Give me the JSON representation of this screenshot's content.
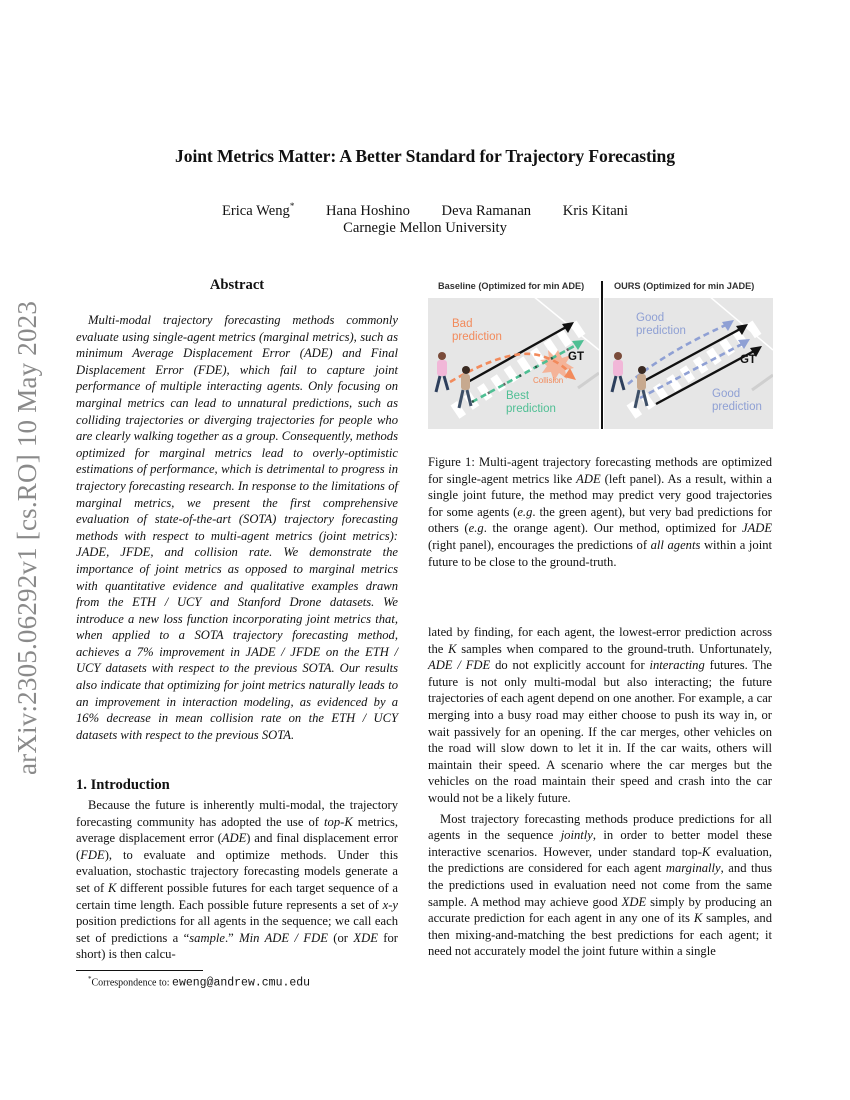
{
  "arxiv_stamp": "arXiv:2305.06292v1  [cs.RO]  10 May 2023",
  "title": "Joint Metrics Matter: A Better Standard for Trajectory Forecasting",
  "authors": [
    {
      "name": "Erica Weng",
      "mark": "*"
    },
    {
      "name": "Hana Hoshino",
      "mark": ""
    },
    {
      "name": "Deva Ramanan",
      "mark": ""
    },
    {
      "name": "Kris Kitani",
      "mark": ""
    }
  ],
  "affiliation": "Carnegie Mellon University",
  "abstract": {
    "heading": "Abstract",
    "text": "Multi-modal trajectory forecasting methods commonly evaluate using single-agent metrics (marginal metrics), such as minimum Average Displacement Error (ADE) and Final Displacement Error (FDE), which fail to capture joint performance of multiple interacting agents. Only focusing on marginal metrics can lead to unnatural predictions, such as colliding trajectories or diverging trajectories for people who are clearly walking together as a group. Consequently, methods optimized for marginal metrics lead to overly-optimistic estimations of performance, which is detrimental to progress in trajectory forecasting research. In response to the limitations of marginal metrics, we present the first comprehensive evaluation of state-of-the-art (SOTA) trajectory forecasting methods with respect to multi-agent metrics (joint metrics): JADE, JFDE, and collision rate. We demonstrate the importance of joint metrics as opposed to marginal metrics with quantitative evidence and qualitative examples drawn from the ETH / UCY and Stanford Drone datasets. We introduce a new loss function incorporating joint metrics that, when applied to a SOTA trajectory forecasting method, achieves a 7% improvement in JADE / JFDE on the ETH / UCY datasets with respect to the previous SOTA. Our results also indicate that optimizing for joint metrics naturally leads to an improvement in interaction modeling, as evidenced by a 16% decrease in mean collision rate on the ETH / UCY datasets with respect to the previous SOTA."
  },
  "introduction": {
    "heading": "1. Introduction",
    "left_segments": [
      {
        "t": "Because the future is inherently multi-modal, the trajectory forecasting community has adopted the use of ",
        "i": false
      },
      {
        "t": "top-K",
        "i": true
      },
      {
        "t": " metrics, average displacement error (",
        "i": false
      },
      {
        "t": "ADE",
        "i": true
      },
      {
        "t": ") and final displacement error (",
        "i": false
      },
      {
        "t": "FDE",
        "i": true
      },
      {
        "t": "), to evaluate and optimize methods. Under this evaluation, stochastic trajectory forecasting models generate a set of ",
        "i": false
      },
      {
        "t": "K",
        "i": true
      },
      {
        "t": " different possible futures for each target sequence of a certain time length. Each possible future represents a set of ",
        "i": false
      },
      {
        "t": "x-y",
        "i": true
      },
      {
        "t": " position predictions for all agents in the sequence; we call each set of predictions a “",
        "i": false
      },
      {
        "t": "sample",
        "i": true
      },
      {
        "t": ".” ",
        "i": false
      },
      {
        "t": "Min ADE / FDE",
        "i": true
      },
      {
        "t": " (or ",
        "i": false
      },
      {
        "t": "XDE",
        "i": true
      },
      {
        "t": " for short) is then calcu-",
        "i": false
      }
    ],
    "right_p1_segments": [
      {
        "t": "lated by finding, for each agent, the lowest-error prediction across the ",
        "i": false
      },
      {
        "t": "K",
        "i": true
      },
      {
        "t": " samples when compared to the ground-truth. Unfortunately, ",
        "i": false
      },
      {
        "t": "ADE / FDE",
        "i": true
      },
      {
        "t": " do not explicitly account for ",
        "i": false
      },
      {
        "t": "interacting",
        "i": true
      },
      {
        "t": " futures. The future is not only multi-modal but also interacting; the future trajectories of each agent depend on one another. For example, a car merging into a busy road may either choose to push its way in, or wait passively for an opening. If the car merges, other vehicles on the road will slow down to let it in. If the car waits, others will maintain their speed. A scenario where the car merges but the vehicles on the road maintain their speed and crash into the car would not be a likely future.",
        "i": false
      }
    ],
    "right_p2_segments": [
      {
        "t": "Most trajectory forecasting methods produce predictions for all agents in the sequence ",
        "i": false
      },
      {
        "t": "jointly",
        "i": true
      },
      {
        "t": ", in order to better model these interactive scenarios. However, under standard top-",
        "i": false
      },
      {
        "t": "K",
        "i": true
      },
      {
        "t": " evaluation, the predictions are considered for each agent ",
        "i": false
      },
      {
        "t": "marginally",
        "i": true
      },
      {
        "t": ", and thus the predictions used in evaluation need not come from the same sample. A method may achieve good ",
        "i": false
      },
      {
        "t": "XDE",
        "i": true
      },
      {
        "t": " simply by producing an accurate prediction for each agent in any one of its ",
        "i": false
      },
      {
        "t": "K",
        "i": true
      },
      {
        "t": " samples, and then mixing-and-matching the best predictions for each agent; it need not accurately model the joint future within a single",
        "i": false
      }
    ]
  },
  "footnote": {
    "mark": "*",
    "label": "Correspondence to: ",
    "email": "eweng@andrew.cmu.edu"
  },
  "figure": {
    "left_title": "Baseline (Optimized for min ADE)",
    "right_title": "OURS (Optimized for min JADE)",
    "left_labels": {
      "bad": "Bad\nprediction",
      "best": "Best\nprediction",
      "collision": "Collision",
      "gt": "GT"
    },
    "right_labels": {
      "good_top": "Good\nprediction",
      "good_bottom": "Good\nprediction",
      "gt": "GT"
    },
    "colors": {
      "bad": "#f28a5b",
      "best": "#4fbf94",
      "good": "#8fa0d4",
      "gt": "#111111",
      "panel_bg": "#e6e6e6"
    },
    "caption_segments": [
      {
        "t": "Figure 1: Multi-agent trajectory forecasting methods are optimized for single-agent metrics like ",
        "i": false
      },
      {
        "t": "ADE",
        "i": true
      },
      {
        "t": " (left panel). As a result, within a single joint future, the method may predict very good trajectories for some agents (",
        "i": false
      },
      {
        "t": "e.g",
        "i": true
      },
      {
        "t": ". the green agent), but very bad predictions for others (",
        "i": false
      },
      {
        "t": "e.g",
        "i": true
      },
      {
        "t": ". the orange agent). Our method, optimized for ",
        "i": false
      },
      {
        "t": "JADE",
        "i": true
      },
      {
        "t": " (right panel), encourages the predictions of ",
        "i": false
      },
      {
        "t": "all agents",
        "i": true
      },
      {
        "t": " within a joint future to be close to the ground-truth.",
        "i": false
      }
    ]
  }
}
